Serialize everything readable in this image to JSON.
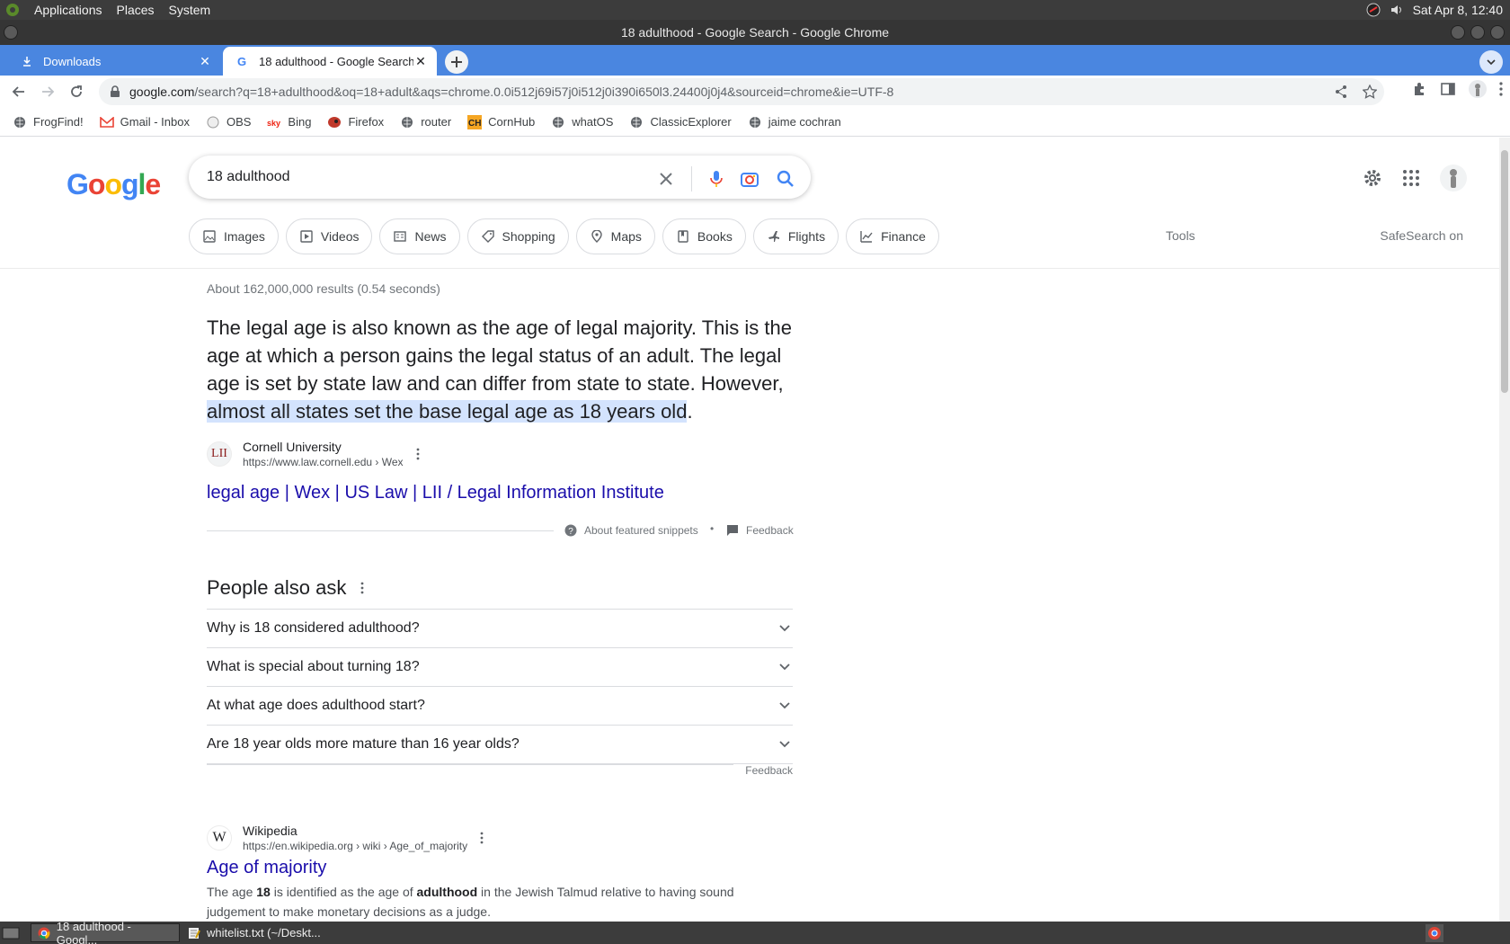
{
  "top_panel": {
    "menus": [
      "Applications",
      "Places",
      "System"
    ],
    "clock": "Sat Apr  8, 12:40"
  },
  "window": {
    "title": "18 adulthood - Google Search - Google Chrome"
  },
  "tabs": [
    {
      "title": "Downloads",
      "icon": "download-icon"
    },
    {
      "title": "18 adulthood - Google Search",
      "icon": "google-g-icon"
    }
  ],
  "omnibox": {
    "host": "google.com",
    "path": "/search?q=18+adulthood&oq=18+adult&aqs=chrome.0.0i512j69i57j0i512j0i390i650l3.24400j0j4&sourceid=chrome&ie=UTF-8"
  },
  "bookmarks": [
    {
      "label": "FrogFind!",
      "icon": "globe-icon"
    },
    {
      "label": "Gmail - Inbox",
      "icon": "gmail-icon"
    },
    {
      "label": "OBS",
      "icon": "github-icon"
    },
    {
      "label": "Bing",
      "icon": "sky-icon"
    },
    {
      "label": "Firefox",
      "icon": "firefox-icon"
    },
    {
      "label": "router",
      "icon": "globe-icon"
    },
    {
      "label": "CornHub",
      "icon": "ch-icon"
    },
    {
      "label": "whatOS",
      "icon": "globe-icon"
    },
    {
      "label": "ClassicExplorer",
      "icon": "globe-icon"
    },
    {
      "label": "jaime cochran",
      "icon": "globe-icon"
    }
  ],
  "search": {
    "query": "18 adulthood"
  },
  "filters": [
    {
      "label": "Images",
      "icon": "image-icon"
    },
    {
      "label": "Videos",
      "icon": "video-icon"
    },
    {
      "label": "News",
      "icon": "news-icon"
    },
    {
      "label": "Shopping",
      "icon": "tag-icon"
    },
    {
      "label": "Maps",
      "icon": "pin-icon"
    },
    {
      "label": "Books",
      "icon": "book-icon"
    },
    {
      "label": "Flights",
      "icon": "plane-icon"
    },
    {
      "label": "Finance",
      "icon": "chart-icon"
    }
  ],
  "tools_label": "Tools",
  "safesearch_label": "SafeSearch on",
  "result_stats": "About 162,000,000 results (0.54 seconds)",
  "snippet": {
    "text": "The legal age is also known as the age of legal majority. This is the age at which a person gains the legal status of an adult. The legal age is set by state law and can differ from state to state. However, ",
    "highlight": "almost all states set the base legal age as 18 years old",
    "tail": ".",
    "source_name": "Cornell University",
    "source_url": "https://www.law.cornell.edu › Wex",
    "favicon_text": "LII",
    "link": "legal age | Wex | US Law | LII / Legal Information Institute",
    "about": "About featured snippets",
    "dot": "•",
    "feedback": "Feedback"
  },
  "paa": {
    "title": "People also ask",
    "questions": [
      "Why is 18 considered adulthood?",
      "What is special about turning 18?",
      "At what age does adulthood start?",
      "Are 18 year olds more mature than 16 year olds?"
    ],
    "feedback": "Feedback"
  },
  "wiki": {
    "source_name": "Wikipedia",
    "source_url": "https://en.wikipedia.org › wiki › Age_of_majority",
    "favicon_text": "W",
    "title": "Age of majority",
    "desc_1": "The age ",
    "desc_b1": "18",
    "desc_2": " is identified as the age of ",
    "desc_b2": "adulthood",
    "desc_3": " in the Jewish Talmud relative to having sound judgement to make monetary decisions as a judge."
  },
  "taskbar": [
    {
      "label": "18 adulthood - Googl...",
      "icon": "chrome-icon",
      "active": true
    },
    {
      "label": "whitelist.txt (~/Deskt...",
      "icon": "text-editor-icon",
      "active": false
    }
  ],
  "colors": {
    "link": "#1a0dab",
    "tabstrip": "#4a86e0",
    "highlight": "#d3e3fd"
  }
}
